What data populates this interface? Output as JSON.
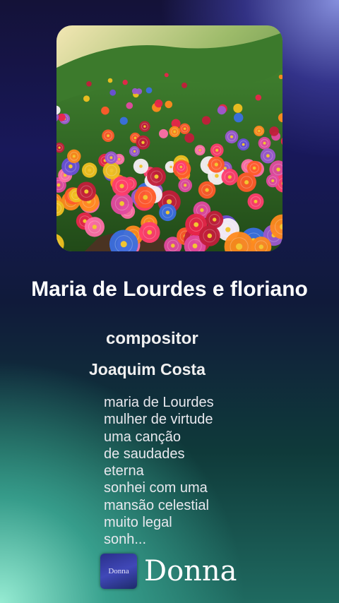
{
  "cover": {
    "alt": "flower-garden-artwork"
  },
  "song": {
    "title": "Maria de Lourdes e floriano",
    "role_label": "compositor",
    "author": "Joaquim Costa"
  },
  "lyrics": [
    "maria de Lourdes",
    "mulher de virtude",
    "uma canção",
    "de saudades",
    "eterna",
    "sonhei com uma",
    "mansão celestial",
    "muito legal",
    "sonh..."
  ],
  "brand": {
    "icon_text": "Donna",
    "name": "Donna"
  },
  "colors": {
    "text": "#ffffff",
    "accent_top_right": "#8c96e6",
    "accent_bottom_left": "#96ebd2"
  }
}
